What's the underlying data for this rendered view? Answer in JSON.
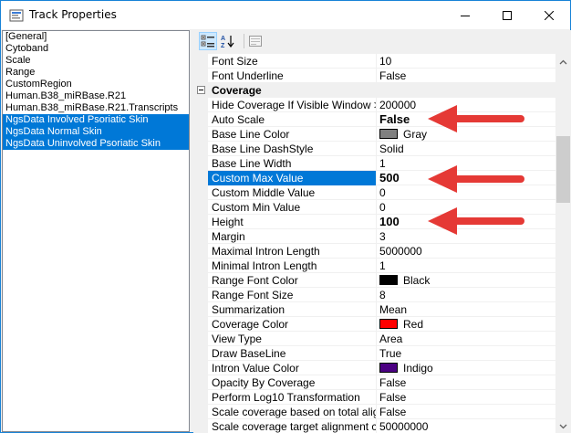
{
  "window": {
    "title": "Track Properties"
  },
  "tracks": [
    {
      "label": "[General]",
      "selected": false
    },
    {
      "label": "Cytoband",
      "selected": false
    },
    {
      "label": "Scale",
      "selected": false
    },
    {
      "label": "Range",
      "selected": false
    },
    {
      "label": "CustomRegion",
      "selected": false
    },
    {
      "label": "Human.B38_miRBase.R21",
      "selected": false
    },
    {
      "label": "Human.B38_miRBase.R21.Transcripts",
      "selected": false
    },
    {
      "label": "NgsData Involved Psoriatic Skin",
      "selected": true
    },
    {
      "label": "NgsData Normal Skin",
      "selected": true
    },
    {
      "label": "NgsData Uninvolved Psoriatic Skin",
      "selected": true
    }
  ],
  "toolbar": {
    "categorized_icon": "categorized-icon",
    "alphabetical_icon": "alphabetical-sort-icon",
    "property_pages_icon": "property-pages-icon"
  },
  "properties": [
    {
      "name": "Font Size",
      "value": "10"
    },
    {
      "name": "Font Underline",
      "value": "False"
    },
    {
      "category": true,
      "name": "Coverage"
    },
    {
      "name": "Hide Coverage If Visible Window >",
      "value": "200000"
    },
    {
      "name": "Auto Scale",
      "value": "False",
      "bold": true
    },
    {
      "name": "Base Line Color",
      "value": "Gray",
      "color": "#808080"
    },
    {
      "name": "Base Line DashStyle",
      "value": "Solid"
    },
    {
      "name": "Base Line Width",
      "value": "1"
    },
    {
      "name": "Custom Max Value",
      "value": "500",
      "bold": true,
      "selected": true
    },
    {
      "name": "Custom Middle Value",
      "value": "0"
    },
    {
      "name": "Custom Min Value",
      "value": "0"
    },
    {
      "name": "Height",
      "value": "100",
      "bold": true
    },
    {
      "name": "Margin",
      "value": "3"
    },
    {
      "name": "Maximal Intron Length",
      "value": "5000000"
    },
    {
      "name": "Minimal Intron Length",
      "value": "1"
    },
    {
      "name": "Range Font Color",
      "value": "Black",
      "color": "#000000"
    },
    {
      "name": "Range Font Size",
      "value": "8"
    },
    {
      "name": "Summarization",
      "value": "Mean"
    },
    {
      "name": "Coverage Color",
      "value": "Red",
      "color": "#ff0000"
    },
    {
      "name": "View Type",
      "value": "Area"
    },
    {
      "name": "Draw BaseLine",
      "value": "True"
    },
    {
      "name": "Intron Value Color",
      "value": "Indigo",
      "color": "#4b0082"
    },
    {
      "name": "Opacity By Coverage",
      "value": "False"
    },
    {
      "name": "Perform Log10 Transformation",
      "value": "False"
    },
    {
      "name": "Scale coverage based on total alignr",
      "value": "False"
    },
    {
      "name": "Scale coverage target alignment cou",
      "value": "50000000"
    }
  ],
  "colors": {
    "accent": "#0078d7",
    "annotation_arrow": "#e53935"
  }
}
